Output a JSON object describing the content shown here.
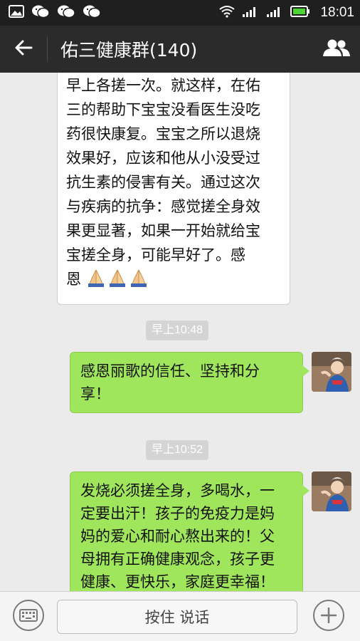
{
  "status_bar": {
    "time": "18:01"
  },
  "header": {
    "title": "佑三健康群(140)"
  },
  "messages": {
    "first": {
      "lines": [
        "早上各搓一次。就这样，在佑",
        "三的帮助下宝宝没看医生没吃",
        "药很快康复。宝宝之所以退烧",
        "效果好，应该和他从小没受过",
        "抗生素的侵害有关。通过这次",
        "与疾病的抗争：感觉搓全身效",
        "果更显著，如果一开始就给宝",
        "宝搓全身，可能早好了。感",
        "恩"
      ]
    },
    "time1": "早上10:48",
    "second": {
      "lines": [
        "感恩丽歌的信任、坚持和分",
        "享！"
      ]
    },
    "time2": "早上10:52",
    "third": {
      "lines": [
        "发烧必须搓全身，多喝水，一",
        "定要出汗！孩子的免疫力是妈",
        "妈的爱心和耐心熬出来的！父",
        "母拥有正确健康观念，孩子更",
        "健康、更快乐，家庭更幸福！"
      ]
    }
  },
  "input_bar": {
    "hold_to_talk": "按住 说话"
  },
  "colors": {
    "accent": "#a0e65c",
    "header": "#2b2b2b",
    "background": "#ebebeb"
  }
}
